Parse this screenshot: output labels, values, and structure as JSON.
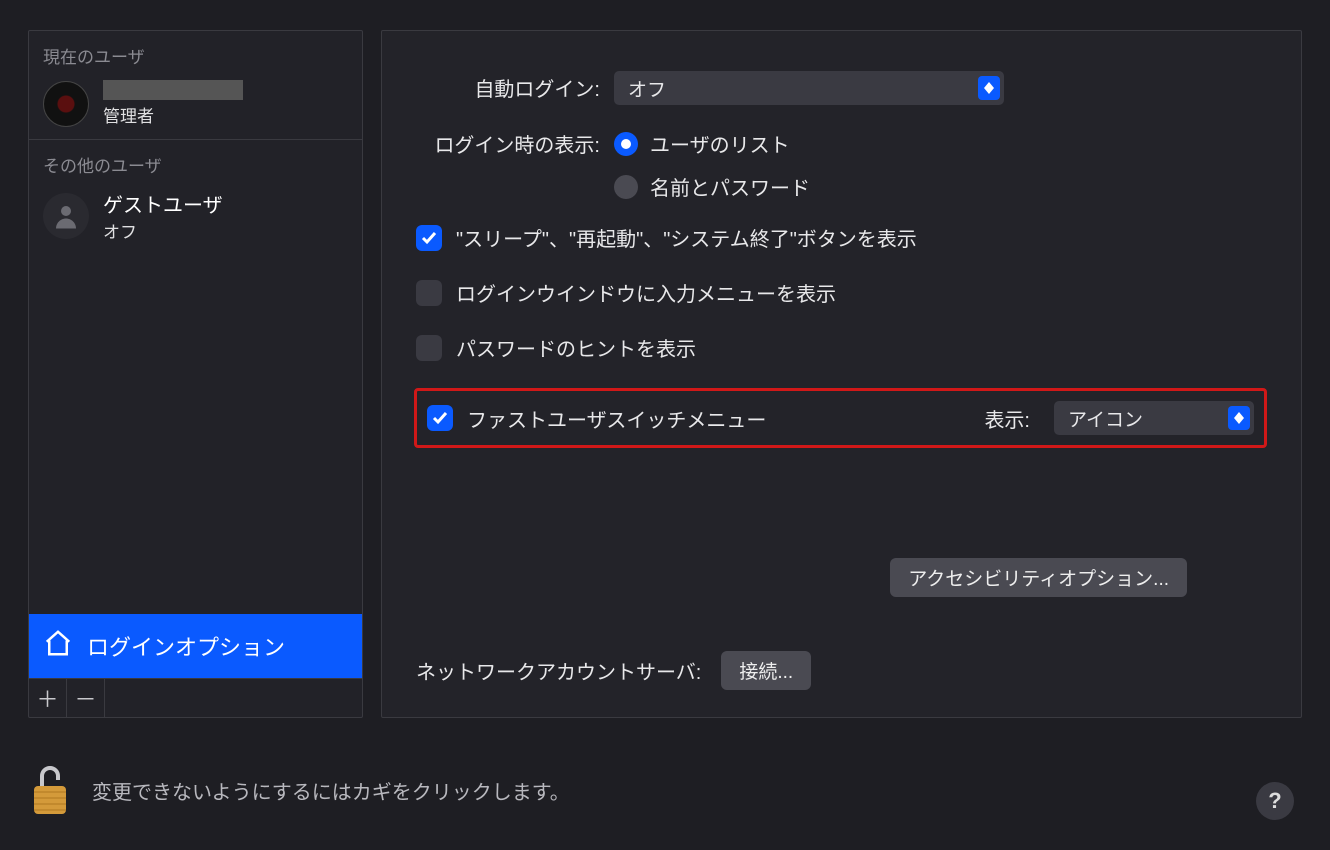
{
  "sidebar": {
    "current_user_header": "現在のユーザ",
    "current_user_role": "管理者",
    "other_users_header": "その他のユーザ",
    "guest_user_name": "ゲストユーザ",
    "guest_user_status": "オフ",
    "login_options_label": "ログインオプション"
  },
  "main": {
    "auto_login_label": "自動ログイン:",
    "auto_login_value": "オフ",
    "login_display_label": "ログイン時の表示:",
    "login_display_option1": "ユーザのリスト",
    "login_display_option2": "名前とパスワード",
    "show_buttons_label": "\"スリープ\"、\"再起動\"、\"システム終了\"ボタンを表示",
    "show_input_menu_label": "ログインウインドウに入力メニューを表示",
    "show_password_hints_label": "パスワードのヒントを表示",
    "fast_user_switch_label": "ファストユーザスイッチメニュー",
    "fast_user_switch_show_label": "表示:",
    "fast_user_switch_value": "アイコン",
    "accessibility_button": "アクセシビリティオプション...",
    "network_server_label": "ネットワークアカウントサーバ:",
    "connect_button": "接続..."
  },
  "lock": {
    "message": "変更できないようにするにはカギをクリックします。"
  },
  "help": {
    "label": "?"
  },
  "checkboxes": {
    "show_buttons": true,
    "show_input_menu": false,
    "show_password_hints": false,
    "fast_user_switch": true
  },
  "radio_selected": "list"
}
